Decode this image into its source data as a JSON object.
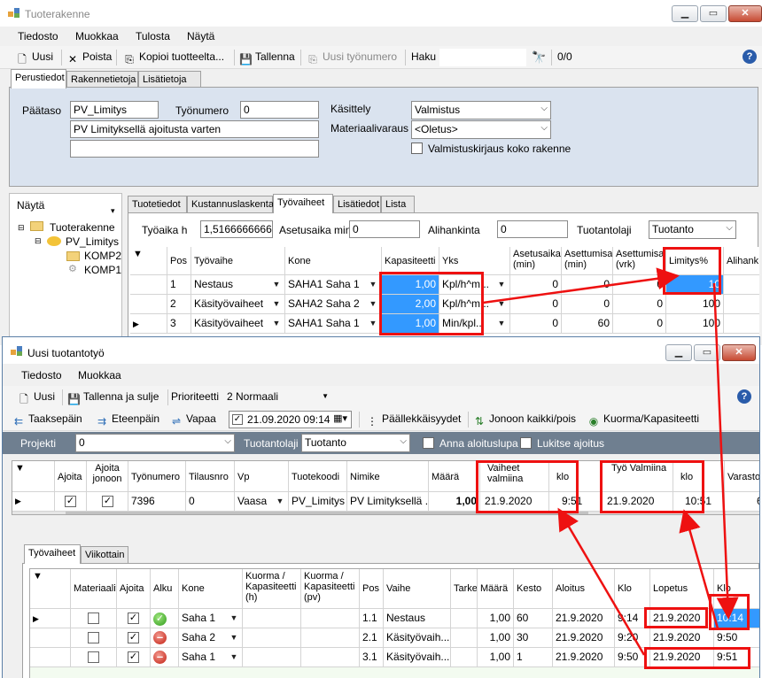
{
  "win1": {
    "title": "Tuoterakenne",
    "menu": [
      "Tiedosto",
      "Muokkaa",
      "Tulosta",
      "Näytä"
    ],
    "toolbar": {
      "new": "Uusi",
      "delete": "Poista",
      "copy": "Kopioi tuotteelta...",
      "save": "Tallenna",
      "new_workno": "Uusi työnumero",
      "search_label": "Haku",
      "search_count": "0/0"
    },
    "tabs": [
      "Perustiedot",
      "Rakennetietoja",
      "Lisätietoja"
    ],
    "form": {
      "paataso_label": "Päätaso",
      "paataso_value": "PV_Limitys",
      "tyonumero_label": "Työnumero",
      "tyonumero_value": "0",
      "description": "PV Limityksellä ajoitusta varten",
      "kasittely_label": "Käsittely",
      "kasittely_value": "Valmistus",
      "materiaalivaraus_label": "Materiaalivaraus",
      "materiaalivaraus_value": "<Oletus>",
      "valmistuskirjaus_label": "Valmistuskirjaus koko rakenne"
    },
    "tree": {
      "header": "Näytä",
      "root": "Tuoterakenne",
      "child": "PV_Limitys",
      "leaf1": "KOMP2",
      "leaf2": "KOMP1"
    },
    "subtabs": [
      "Tuotetiedot",
      "Kustannuslaskenta",
      "Työvaiheet",
      "Lisätiedot",
      "Lista"
    ],
    "tyoaika_label": "Työaika h",
    "tyoaika_value": "1,51666666666",
    "asetusaika_label": "Asetusaika min",
    "asetusaika_value": "0",
    "alihankinta_label": "Alihankinta",
    "alihankinta_value": "0",
    "tuotantolaji_label": "Tuotantolaji",
    "tuotantolaji_value": "Tuotanto",
    "columns": [
      "Pos",
      "Työvaihe",
      "Kone",
      "Kapasiteetti",
      "Yks",
      "Asetusaika (min)",
      "Asettumisa (min)",
      "Asettumisa (vrk)",
      "Limitys%",
      "Alihank"
    ],
    "rows": [
      {
        "pos": "1",
        "vaihe": "Nestaus",
        "kone": "SAHA1 Saha 1",
        "kap": "1,00",
        "yks": "Kpl/h^m...",
        "aset": "0",
        "asmin": "0",
        "asvrk": "0",
        "lim": "10"
      },
      {
        "pos": "2",
        "vaihe": "Käsityövaiheet",
        "kone": "SAHA2 Saha 2",
        "kap": "2,00",
        "yks": "Kpl/h^m...",
        "aset": "0",
        "asmin": "0",
        "asvrk": "0",
        "lim": "100"
      },
      {
        "pos": "3",
        "vaihe": "Käsityövaiheet",
        "kone": "SAHA1 Saha 1",
        "kap": "1,00",
        "yks": "Min/kpl...",
        "aset": "0",
        "asmin": "60",
        "asvrk": "0",
        "lim": "100"
      }
    ]
  },
  "win2": {
    "title": "Uusi tuotantotyö",
    "menu": [
      "Tiedosto",
      "Muokkaa"
    ],
    "toolbar1": {
      "new": "Uusi",
      "save_close": "Tallenna ja sulje",
      "priority_label": "Prioriteetti",
      "priority_value": "2 Normaali"
    },
    "toolbar2": {
      "back": "Taaksepäin",
      "forward": "Eteenpäin",
      "free": "Vapaa",
      "datetime": "21.09.2020 09:14",
      "overlaps": "Päällekkäisyydet",
      "queue_all": "Jonoon kaikki/pois",
      "load": "Kuorma/Kapasiteetti"
    },
    "filter": {
      "projekti_label": "Projekti",
      "projekti_value": "0",
      "tuotantolaji_label": "Tuotantolaji",
      "tuotantolaji_value": "Tuotanto",
      "anna_label": "Anna aloituslupa",
      "lukitse_label": "Lukitse ajoitus"
    },
    "columns": [
      "Ajoita",
      "Ajoita jonoon",
      "Työnumero",
      "Tilausnro",
      "Vp",
      "Tuotekoodi",
      "Nimike",
      "Määrä",
      "Vaiheet valmiina",
      "klo",
      "Työ Valmiina",
      "klo",
      "Varasto"
    ],
    "row": {
      "tyonumero": "7396",
      "tilausnro": "0",
      "vp": "Vaasa",
      "tuotekoodi": "PV_Limitys",
      "nimike": "PV Limityksellä ...",
      "maara": "1,00",
      "vaiheet_pvm": "21.9.2020",
      "vaiheet_klo": "9:51",
      "tyo_pvm": "21.9.2020",
      "tyo_klo": "10:51",
      "varasto": "6,"
    },
    "tabs": [
      "Työvaiheet",
      "Viikottain"
    ],
    "phase_columns": [
      "Materiaalit",
      "Ajoita",
      "Alku",
      "Kone",
      "Kuorma / Kapasiteetti (h)",
      "Kuorma / Kapasiteetti (pv)",
      "Pos",
      "Vaihe",
      "Tarke",
      "Määrä",
      "Kesto",
      "Aloitus",
      "Klo",
      "Lopetus",
      "Klo"
    ],
    "phases": [
      {
        "status": "ok",
        "kone": "Saha 1",
        "pos": "1.1",
        "vaihe": "Nestaus",
        "maara": "1,00",
        "kesto": "60",
        "aloitus": "21.9.2020",
        "klo1": "9:14",
        "lopetus": "21.9.2020",
        "klo2": "10:14"
      },
      {
        "status": "no",
        "kone": "Saha 2",
        "pos": "2.1",
        "vaihe": "Käsityövaih...",
        "maara": "1,00",
        "kesto": "30",
        "aloitus": "21.9.2020",
        "klo1": "9:20",
        "lopetus": "21.9.2020",
        "klo2": "9:50"
      },
      {
        "status": "no",
        "kone": "Saha 1",
        "pos": "3.1",
        "vaihe": "Käsityövaih...",
        "maara": "1,00",
        "kesto": "1",
        "aloitus": "21.9.2020",
        "klo1": "9:50",
        "lopetus": "21.9.2020",
        "klo2": "9:51"
      }
    ]
  },
  "colors": {
    "highlight_blue": "#3399ff",
    "annotation_red": "#ee1111",
    "filter_bar": "#6f7f90"
  }
}
